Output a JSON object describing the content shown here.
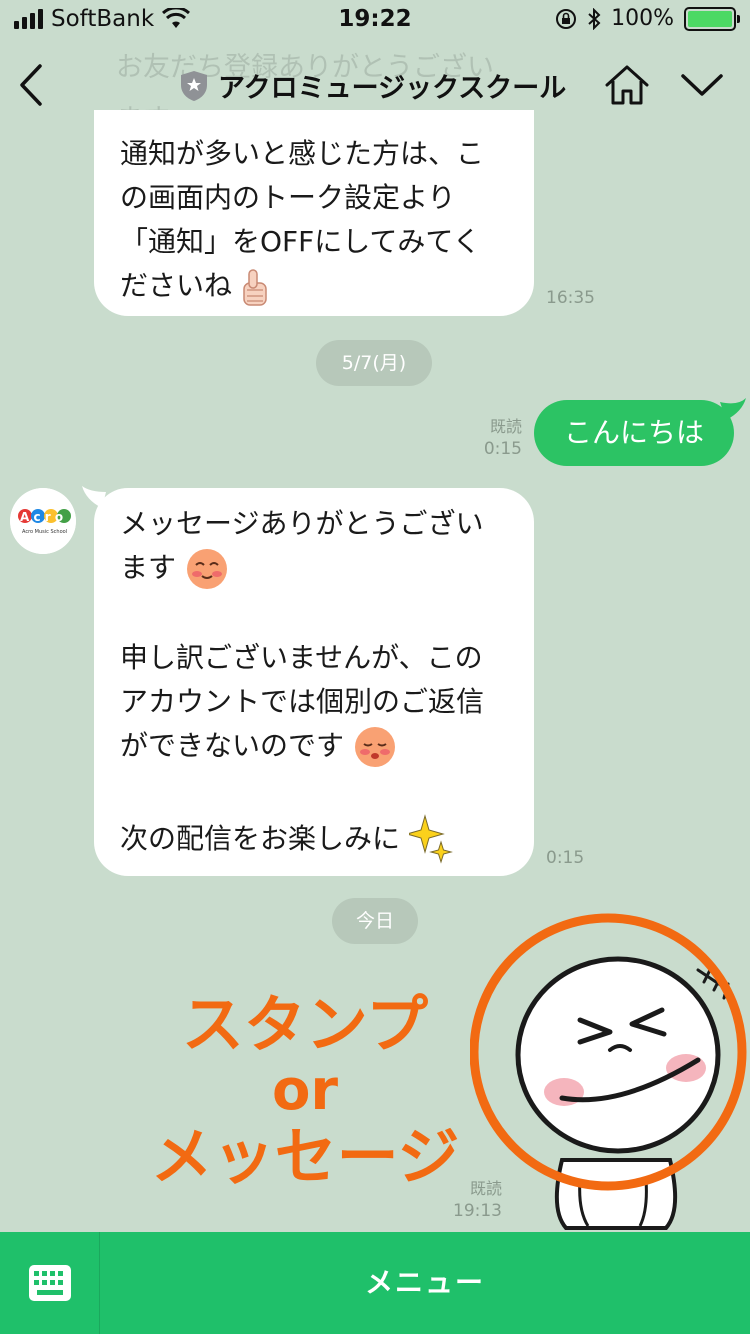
{
  "status_bar": {
    "carrier": "SoftBank",
    "time": "19:22",
    "battery_percent": "100%",
    "battery_level": 1.0
  },
  "header": {
    "title": "アクロミュージックスクール",
    "faded_previous_text": "お友だち登録ありがとうございます"
  },
  "messages": {
    "m1": {
      "lines": [
        "通知が多いと感じた方は、こ",
        "の画面内のトーク設定より",
        "「通知」をOFFにしてみてく",
        "ださいね"
      ],
      "time": "16:35"
    },
    "date1": "5/7(月)",
    "m2": {
      "text": "こんにちは",
      "read": "既読",
      "time": "0:15"
    },
    "m3": {
      "lines": [
        "メッセージありがとうござい",
        "ます",
        "申し訳ございませんが、この",
        "アカウントでは個別のご返信",
        "ができないのです",
        "次の配信をお楽しみに"
      ],
      "time": "0:15"
    },
    "date2": "今日",
    "m4": {
      "read": "既読",
      "time": "19:13"
    }
  },
  "annotation": {
    "line1": "スタンプ",
    "line2": "or",
    "line3": "メッセージ",
    "color": "#f26a12"
  },
  "avatar": {
    "logo_text": "Acro",
    "sub_text": "Acro Music School"
  },
  "bottom_bar": {
    "menu_label": "メニュー"
  },
  "colors": {
    "background": "#c9dccd",
    "accent_green": "#2cc364",
    "bottom_green": "#1fc06a"
  },
  "icons": [
    "back-icon",
    "shield-icon",
    "home-icon",
    "chevron-down-icon",
    "keyboard-icon",
    "thumbs-up-icon",
    "blush-face-icon",
    "sad-face-icon",
    "sparkles-icon"
  ]
}
